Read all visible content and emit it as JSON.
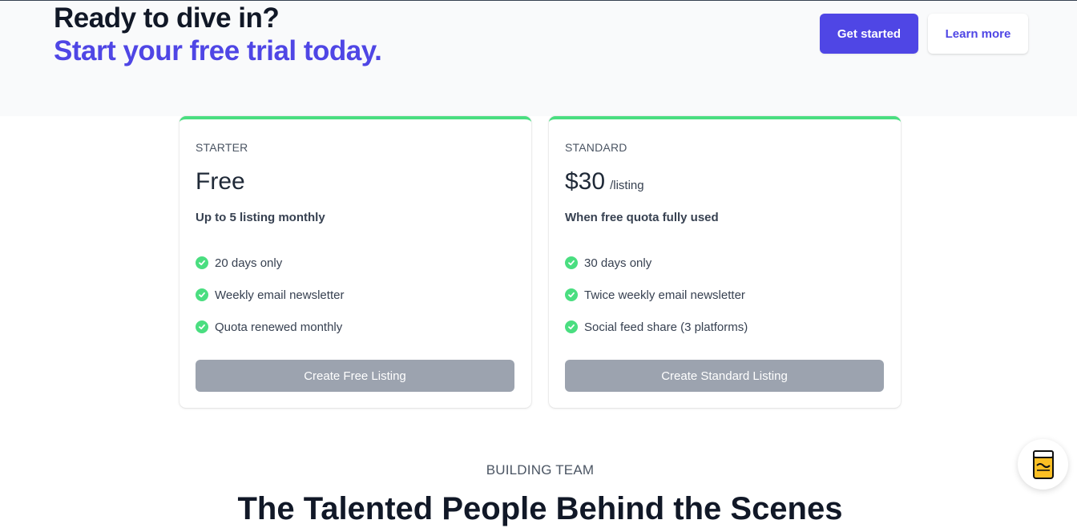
{
  "cta": {
    "title": "Ready to dive in?",
    "subtitle": "Start your free trial today.",
    "primary_button": "Get started",
    "secondary_button": "Learn more"
  },
  "plans": [
    {
      "tier": "STARTER",
      "price": "Free",
      "unit": "",
      "description": "Up to 5 listing monthly",
      "features": [
        "20 days only",
        "Weekly email newsletter",
        "Quota renewed monthly"
      ],
      "button": "Create Free Listing"
    },
    {
      "tier": "STANDARD",
      "price": "$30",
      "unit": "/listing",
      "description": "When free quota fully used",
      "features": [
        "30 days only",
        "Twice weekly email newsletter",
        "Social feed share (3 platforms)"
      ],
      "button": "Create Standard Listing"
    }
  ],
  "team": {
    "label": "BUILDING TEAM",
    "heading": "The Talented People Behind the Scenes"
  },
  "widget": {
    "icon": "buy-me-a-beer-icon"
  },
  "colors": {
    "brand": "#4f46e5",
    "accent_green": "#4ade80",
    "disabled_button": "#9ca3af",
    "band_background": "#f9fafb"
  }
}
